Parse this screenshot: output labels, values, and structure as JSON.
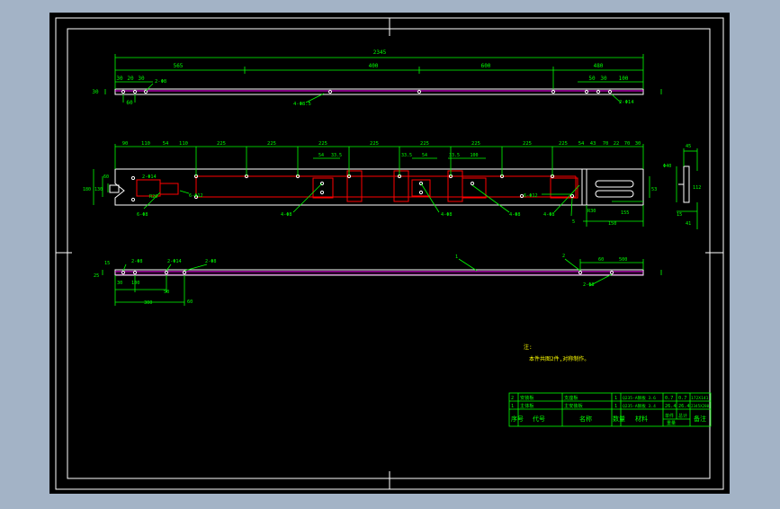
{
  "colors": {
    "outer_bg": "#a3b3c6",
    "canvas_bg": "#000000",
    "frame": "#ffffff",
    "dimension": "#00ff00",
    "part_outline": "#ffffff",
    "hidden_part": "#ff0000",
    "marker": "#ff00ff",
    "note_text": "#ffff00"
  },
  "top_view": {
    "overall_dim": "2345",
    "segment_dims": [
      "565",
      "400",
      "600",
      "480"
    ],
    "left_dims": [
      "30",
      "20",
      "30",
      "50"
    ],
    "right_dims": [
      "50",
      "30",
      "100"
    ],
    "height_dim": "30",
    "left_sub_dim": "60",
    "holes_left_label": "2-Φ8",
    "holes_mid_label": "4-Φ8.5",
    "holes_right_label": "2-Φ14"
  },
  "middle_view": {
    "top_dims": [
      "90",
      "110",
      "54",
      "110",
      "225",
      "225",
      "225",
      "225",
      "225",
      "225",
      "225",
      "225",
      "54",
      "43",
      "70",
      "22",
      "70",
      "30"
    ],
    "sub_dims": [
      "54",
      "33.5",
      "33.5",
      "54",
      "33.5",
      "100"
    ],
    "left_v_dims": [
      "180",
      "130",
      "60"
    ],
    "left_labels": [
      "2-Φ14",
      "6-Φ8",
      "R20"
    ],
    "hole_labels": [
      "6-Φ12",
      "4-Φ8",
      "4-Φ8",
      "4-Φ8",
      "6-Φ12",
      "4-Φ8"
    ],
    "right_labels": [
      "R30",
      "150",
      "155",
      "5",
      "53"
    ],
    "side_dims": [
      "45",
      "Φ40",
      "112",
      "15",
      "41"
    ]
  },
  "bottom_view": {
    "dims": [
      "30",
      "100",
      "50",
      "300",
      "60",
      "60",
      "500",
      "15",
      "25"
    ],
    "labels": [
      "2-Φ8",
      "2-Φ14",
      "2-Φ8",
      "1",
      "2",
      "2-Φ8"
    ]
  },
  "notes": {
    "title": "注:",
    "line1": "本件共图2件,对称制作。"
  },
  "title_block": {
    "rows": [
      [
        "2",
        "安装板",
        "支座板",
        "1",
        "Q235-A钢板 3.6",
        "0.7",
        "0.7",
        "172X141"
      ],
      [
        "1",
        "主体板",
        "主安装板",
        "1",
        "Q235-A钢板 3.4",
        "26.4",
        "26.4",
        "2345X280"
      ]
    ],
    "header": [
      "序号",
      "代号",
      "名称",
      "数量",
      "材料",
      "单件",
      "总计",
      "备注"
    ],
    "sub_header": "重量"
  }
}
